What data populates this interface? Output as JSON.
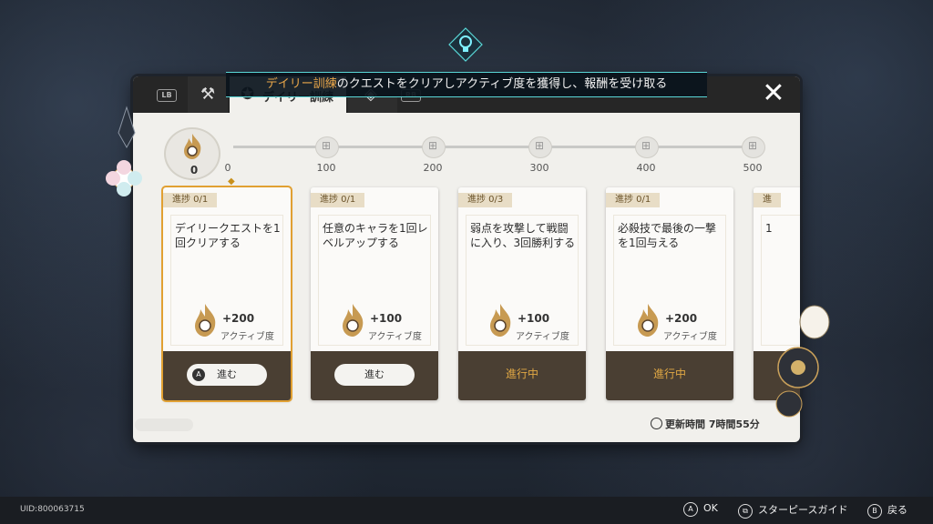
{
  "hint": {
    "highlight": "デイリー訓練",
    "rest": "のクエストをクリアしアクティブ度を獲得し、報酬を受け取る"
  },
  "tabs": {
    "lb": "LB",
    "rb": "RB",
    "active_label": "デイリー訓練"
  },
  "progress": {
    "current": "0",
    "milestones": [
      "0",
      "100",
      "200",
      "300",
      "400",
      "500"
    ]
  },
  "cards": [
    {
      "tag": "進捗 0/1",
      "text": "デイリークエストを1回クリアする",
      "reward": "+200",
      "reward_label": "アクティブ度",
      "action": "進む",
      "has_a": true
    },
    {
      "tag": "進捗 0/1",
      "text": "任意のキャラを1回レベルアップする",
      "reward": "+100",
      "reward_label": "アクティブ度",
      "action": "進む",
      "has_a": false
    },
    {
      "tag": "進捗 0/3",
      "text": "弱点を攻撃して戦闘に入り、3回勝利する",
      "reward": "+100",
      "reward_label": "アクティブ度",
      "status": "進行中"
    },
    {
      "tag": "進捗 0/1",
      "text": "必殺技で最後の一撃を1回与える",
      "reward": "+200",
      "reward_label": "アクティブ度",
      "status": "進行中"
    },
    {
      "tag": "進",
      "text": "1"
    }
  ],
  "refresh": "更新時間 7時間55分",
  "footer": {
    "uid": "UID:800063715",
    "ok": "OK",
    "guide": "スターピースガイド",
    "back": "戻る",
    "a_key": "A",
    "b_key": "B"
  },
  "colors": {
    "accent": "#e1a032",
    "footer_card": "#4a3f33",
    "hint_border": "#5ad8d8"
  }
}
